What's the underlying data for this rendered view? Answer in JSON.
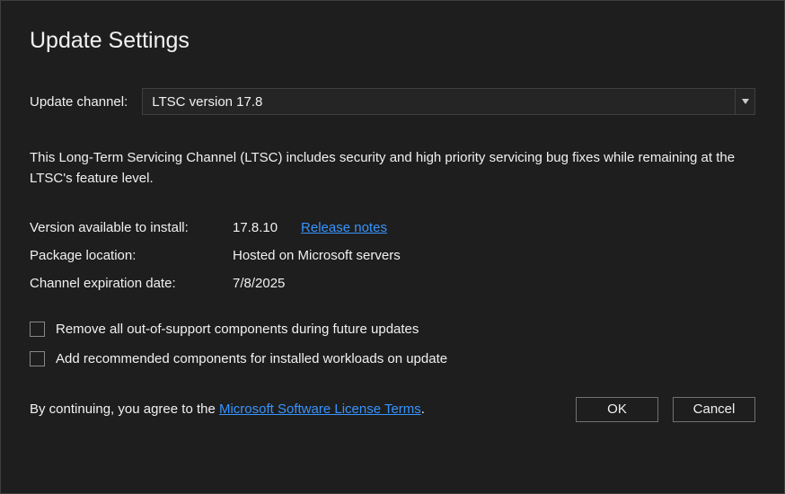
{
  "title": "Update Settings",
  "channel": {
    "label": "Update channel:",
    "selected": "LTSC version 17.8"
  },
  "description": "This Long-Term Servicing Channel (LTSC) includes security and high priority servicing bug fixes while remaining at the LTSC's feature level.",
  "info": {
    "version_label": "Version available to install:",
    "version_value": "17.8.10",
    "release_notes_link": "Release notes",
    "package_label": "Package location:",
    "package_value": "Hosted on Microsoft servers",
    "expiration_label": "Channel expiration date:",
    "expiration_value": "7/8/2025"
  },
  "checkboxes": {
    "remove_components": "Remove all out-of-support components during future updates",
    "add_recommended": "Add recommended components for installed workloads on update"
  },
  "footer": {
    "agree_prefix": "By continuing, you agree to the ",
    "license_link": "Microsoft Software License Terms",
    "agree_suffix": ".",
    "ok": "OK",
    "cancel": "Cancel"
  }
}
